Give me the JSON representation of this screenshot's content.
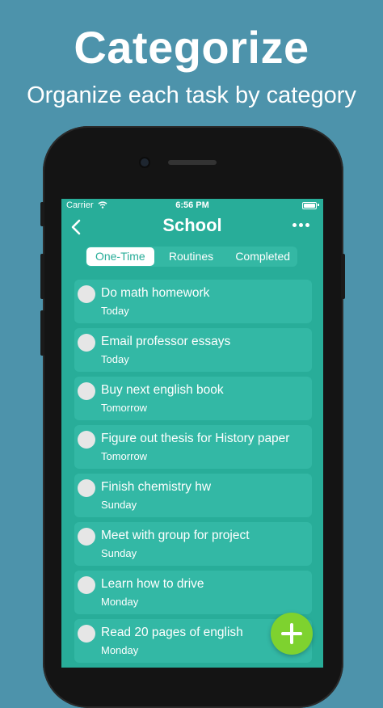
{
  "promo": {
    "title": "Categorize",
    "subtitle": "Organize each task by category"
  },
  "status_bar": {
    "carrier": "Carrier",
    "time": "6:56 PM"
  },
  "nav": {
    "title": "School",
    "back_icon": "chevron-left-icon",
    "more_icon": "ellipsis-icon"
  },
  "tabs": [
    {
      "label": "One-Time",
      "active": true
    },
    {
      "label": "Routines",
      "active": false
    },
    {
      "label": "Completed",
      "active": false
    }
  ],
  "tasks": [
    {
      "title": "Do math homework",
      "due": "Today"
    },
    {
      "title": "Email professor essays",
      "due": "Today"
    },
    {
      "title": "Buy next english book",
      "due": "Tomorrow"
    },
    {
      "title": "Figure out thesis for History paper",
      "due": "Tomorrow"
    },
    {
      "title": "Finish chemistry hw",
      "due": "Sunday"
    },
    {
      "title": "Meet with group for project",
      "due": "Sunday"
    },
    {
      "title": "Learn how to drive",
      "due": "Monday"
    },
    {
      "title": "Read 20 pages of english",
      "due": "Monday"
    }
  ],
  "fab": {
    "icon": "plus-icon"
  },
  "colors": {
    "background": "#4d93ab",
    "screen": "#28ad99",
    "task_card": "#33b8a5",
    "fab": "#7ed22f"
  }
}
